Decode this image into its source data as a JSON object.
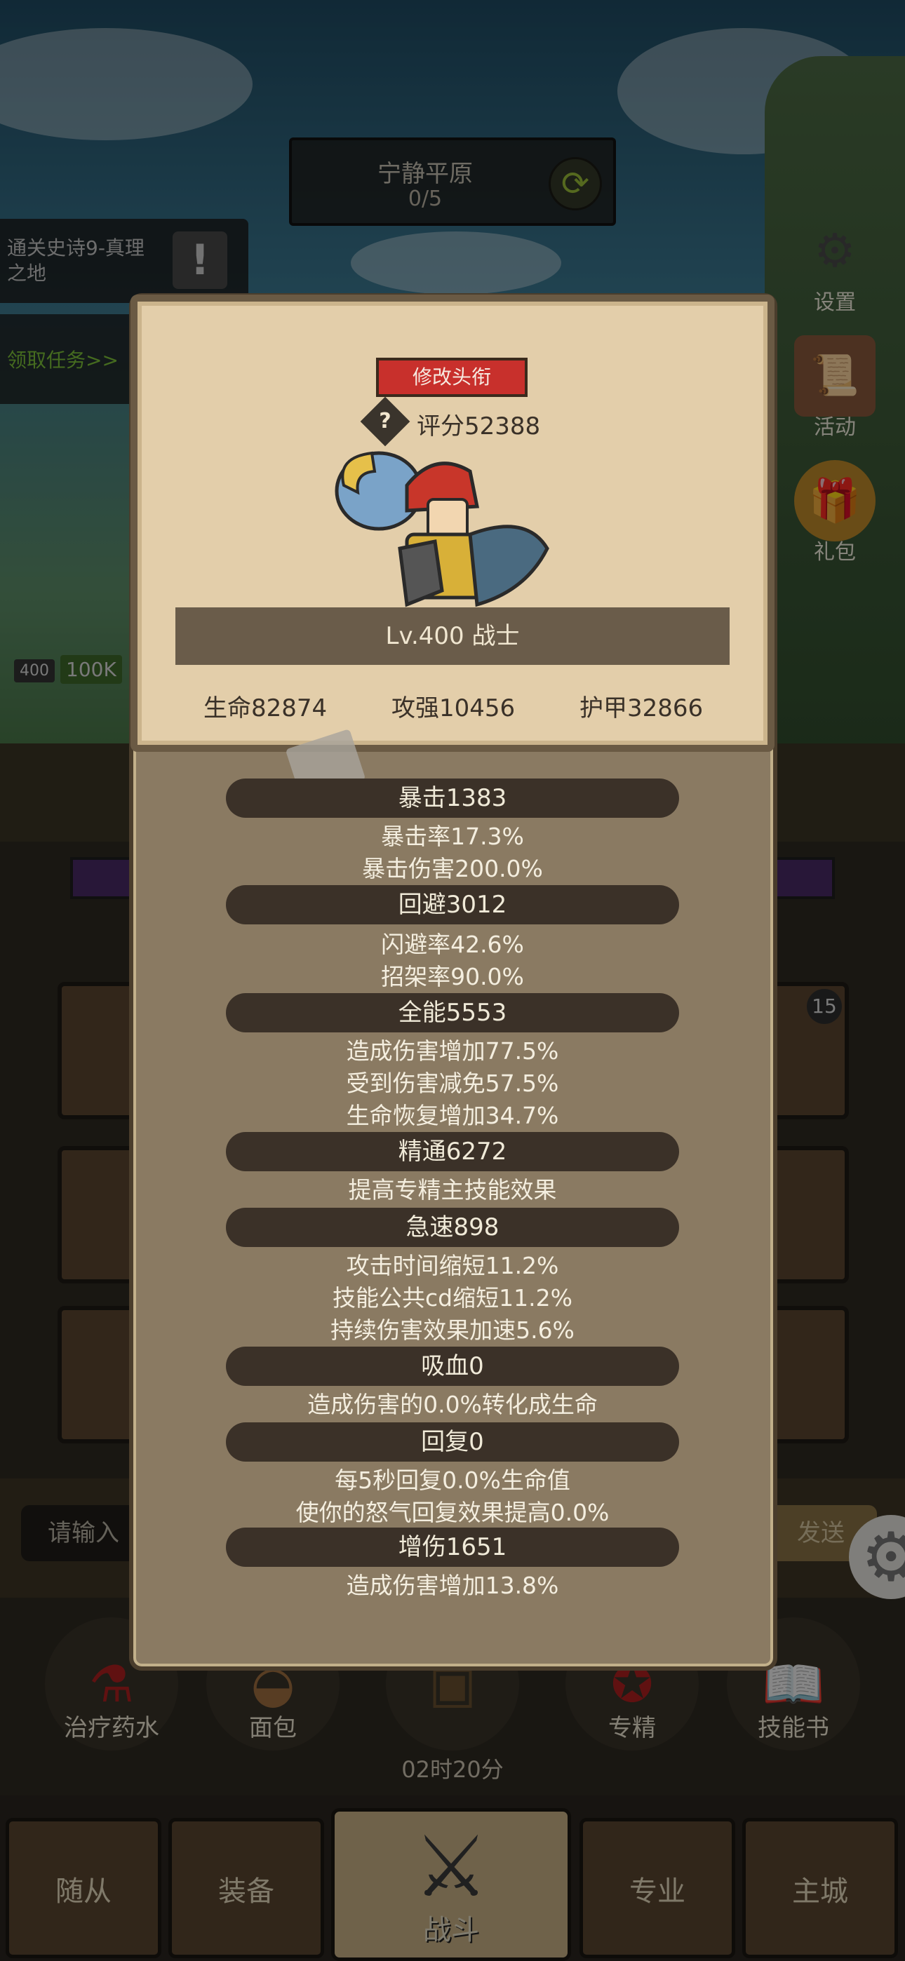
{
  "zone": {
    "name": "宁静平原",
    "progress": "0/5",
    "refresh_icon": "refresh-icon"
  },
  "quest": {
    "text": "通关史诗9-真理之地",
    "claim_label": "领取任务>>",
    "alert_icon": "exclamation-icon"
  },
  "side_menu": [
    {
      "label": "设置",
      "icon": "gear-icon"
    },
    {
      "label": "活动",
      "icon": "scroll-icon"
    },
    {
      "label": "礼包",
      "icon": "gift-icon"
    }
  ],
  "enemy": {
    "level": "400",
    "hp": "100K"
  },
  "slots": {
    "badge": "15"
  },
  "chat": {
    "placeholder": "请输入",
    "send_label": "发送"
  },
  "items": [
    {
      "label": "治疗药水",
      "icon": "potion-icon"
    },
    {
      "label": "面包",
      "icon": "bread-icon"
    },
    {
      "label": "专精",
      "icon": "mastery-icon"
    },
    {
      "label": "技能书",
      "icon": "book-icon"
    }
  ],
  "timer": "02时20分",
  "nav": {
    "follower": "随从",
    "equipment": "装备",
    "battle": "战斗",
    "profession": "专业",
    "city": "主城"
  },
  "panel": {
    "edit_title_label": "修改头衔",
    "score": "评分52388",
    "name_bar": "Lv.400 战士",
    "hp": "生命82874",
    "attack": "攻强10456",
    "armor": "护甲32866",
    "sections": [
      {
        "head": "暴击1383",
        "lines": [
          "暴击率17.3%",
          "暴击伤害200.0%"
        ]
      },
      {
        "head": "回避3012",
        "lines": [
          "闪避率42.6%",
          "招架率90.0%"
        ]
      },
      {
        "head": "全能5553",
        "lines": [
          "造成伤害增加77.5%",
          "受到伤害减免57.5%",
          "生命恢复增加34.7%"
        ]
      },
      {
        "head": "精通6272",
        "lines": [
          "提高专精主技能效果"
        ]
      },
      {
        "head": "急速898",
        "lines": [
          "攻击时间缩短11.2%",
          "技能公共cd缩短11.2%",
          "持续伤害效果加速5.6%"
        ]
      },
      {
        "head": "吸血0",
        "lines": [
          "造成伤害的0.0%转化成生命"
        ]
      },
      {
        "head": "回复0",
        "lines": [
          "每5秒回复0.0%生命值",
          "使你的怒气回复效果提高0.0%"
        ]
      },
      {
        "head": "增伤1651",
        "lines": [
          "造成伤害增加13.8%"
        ]
      }
    ]
  }
}
